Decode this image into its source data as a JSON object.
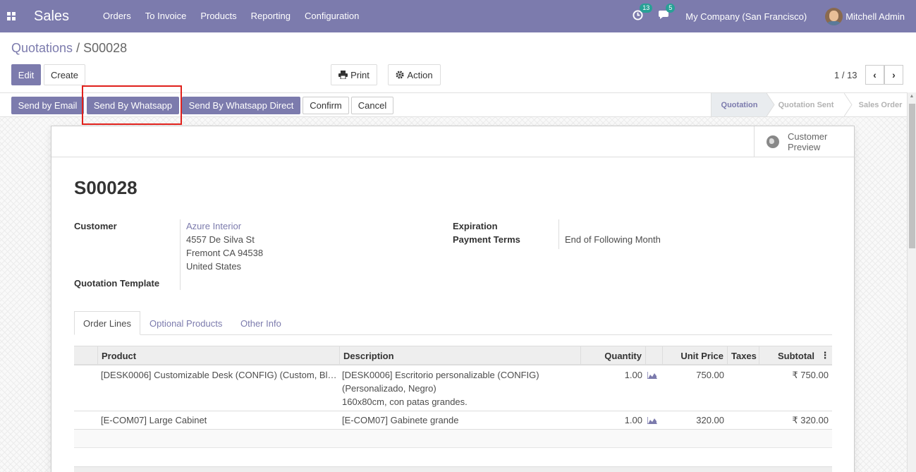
{
  "navbar": {
    "app_name": "Sales",
    "menu": [
      "Orders",
      "To Invoice",
      "Products",
      "Reporting",
      "Configuration"
    ],
    "activity_count": "13",
    "message_count": "5",
    "company": "My Company (San Francisco)",
    "user": "Mitchell Admin"
  },
  "breadcrumb": {
    "parent": "Quotations",
    "separator": "/",
    "current": "S00028"
  },
  "control": {
    "edit": "Edit",
    "create": "Create",
    "print": "Print",
    "action": "Action",
    "pager": "1 / 13"
  },
  "statusbar": {
    "buttons": [
      "Send by Email",
      "Send By Whatsapp",
      "Send By Whatsapp Direct",
      "Confirm",
      "Cancel"
    ],
    "stages": [
      "Quotation",
      "Quotation Sent",
      "Sales Order"
    ],
    "active_stage": "Quotation"
  },
  "sheet": {
    "preview_label": "Customer Preview",
    "title": "S00028",
    "customer_label": "Customer",
    "customer_name": "Azure Interior",
    "address": [
      "4557 De Silva St",
      "Fremont CA 94538",
      "United States"
    ],
    "template_label": "Quotation Template",
    "expiration_label": "Expiration",
    "payment_terms_label": "Payment Terms",
    "payment_terms": "End of Following Month"
  },
  "tabs": [
    "Order Lines",
    "Optional Products",
    "Other Info"
  ],
  "order_lines": {
    "columns": [
      "Product",
      "Description",
      "Quantity",
      "Unit Price",
      "Taxes",
      "Subtotal"
    ],
    "rows": [
      {
        "product": "[DESK0006] Customizable Desk (CONFIG) (Custom, Bl…",
        "description": [
          "[DESK0006] Escritorio personalizable (CONFIG)",
          "(Personalizado, Negro)",
          "160x80cm, con patas grandes."
        ],
        "quantity": "1.00",
        "unit_price": "750.00",
        "taxes": "",
        "subtotal": "₹ 750.00"
      },
      {
        "product": "[E-COM07] Large Cabinet",
        "description": [
          "[E-COM07] Gabinete grande"
        ],
        "quantity": "1.00",
        "unit_price": "320.00",
        "taxes": "",
        "subtotal": "₹ 320.00"
      }
    ]
  },
  "colors": {
    "brand": "#7c7bad",
    "badge": "#28a096",
    "highlight": "#e0201b"
  },
  "icons": [
    "apps-icon",
    "activity-clock-icon",
    "chat-icon",
    "print-icon",
    "gear-icon",
    "chevron-left-icon",
    "chevron-right-icon",
    "globe-icon",
    "forecast-chart-icon",
    "column-options-icon"
  ]
}
